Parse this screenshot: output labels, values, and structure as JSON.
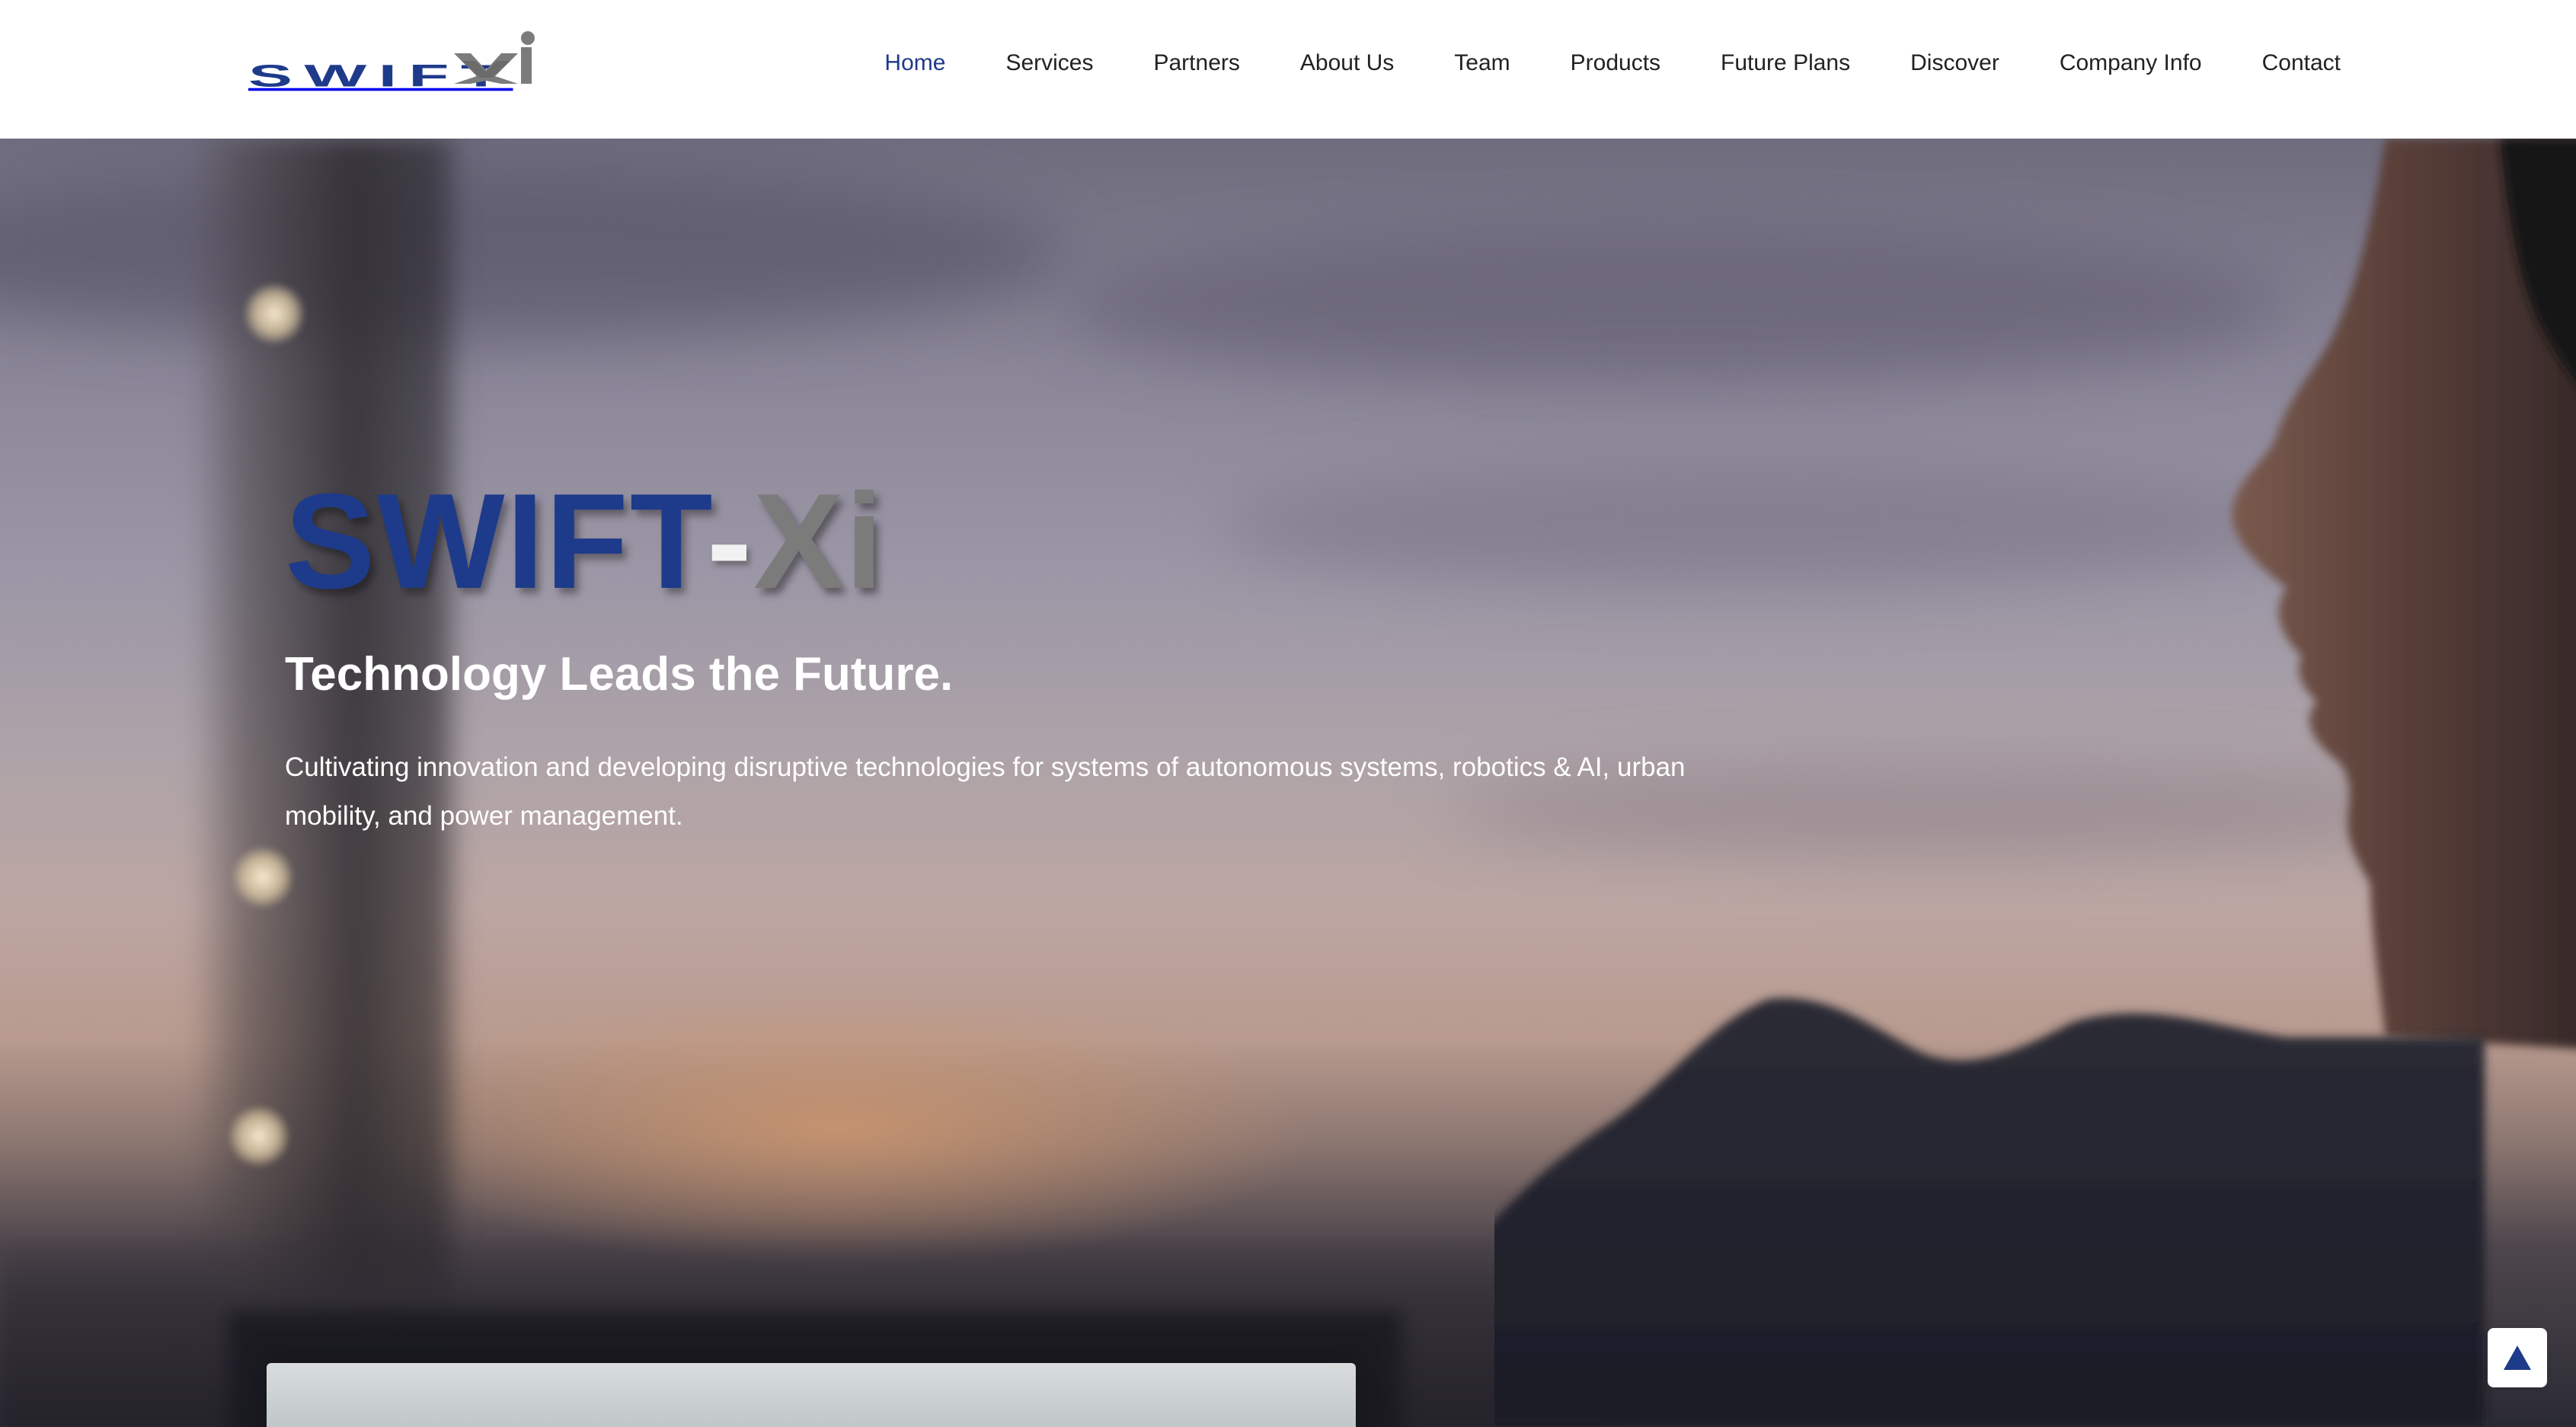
{
  "header": {
    "logo_text": "SWIFT Xi",
    "logo_colors": {
      "primary": "#1e3a8a",
      "secondary": "#7b7b7b"
    },
    "nav": [
      {
        "label": "Home",
        "active": true
      },
      {
        "label": "Services",
        "active": false
      },
      {
        "label": "Partners",
        "active": false
      },
      {
        "label": "About Us",
        "active": false
      },
      {
        "label": "Team",
        "active": false
      },
      {
        "label": "Products",
        "active": false
      },
      {
        "label": "Future Plans",
        "active": false
      },
      {
        "label": "Discover",
        "active": false
      },
      {
        "label": "Company Info",
        "active": false
      },
      {
        "label": "Contact",
        "active": false
      }
    ]
  },
  "hero": {
    "brand_swift": "SWIFT",
    "brand_dash": "-",
    "brand_xi": "Xi",
    "tagline": "Technology Leads the Future.",
    "description": "Cultivating innovation and developing disruptive technologies for systems of autonomous systems, robotics & AI, urban mobility, and power management.",
    "background_image": "person-at-dusk-with-laptop"
  },
  "scroll_top": {
    "icon": "triangle-up-icon",
    "color": "#1e3a8a"
  },
  "colors": {
    "accent": "#1e3a8a",
    "nav_text": "#222222",
    "hero_text": "#ffffff"
  }
}
